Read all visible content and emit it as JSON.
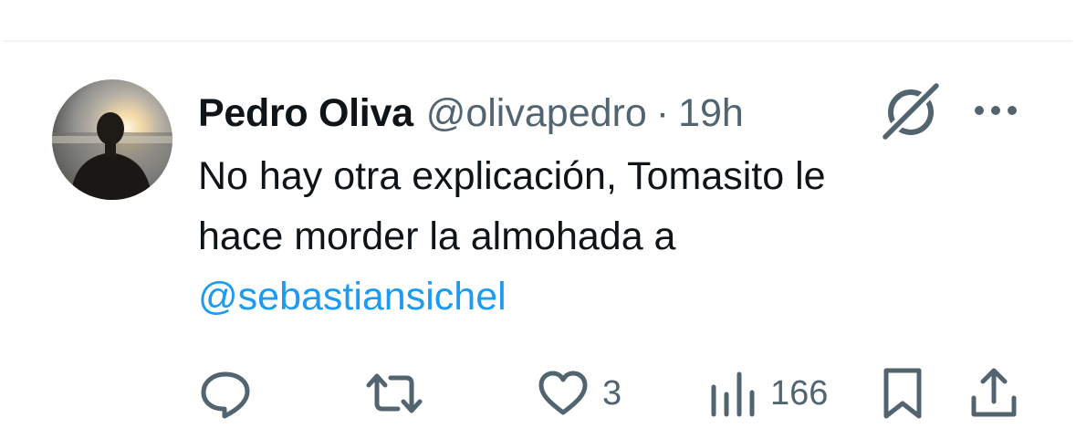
{
  "tweet": {
    "author_name": "Pedro Oliva",
    "author_handle": "@olivapedro",
    "separator": "·",
    "timestamp": "19h",
    "text_lines": [
      "No hay otra explicación, Tomasito le",
      "hace morder la almohada a"
    ],
    "mention": "@sebastiansichel"
  },
  "actions": {
    "likes": "3",
    "views": "166"
  },
  "icons": {
    "avatar": "profile-photo-sunset-silhouette",
    "grok": "grok-icon",
    "more": "more-horizontal-icon",
    "reply": "reply-icon",
    "retweet": "retweet-icon",
    "like": "heart-icon",
    "views": "views-bar-chart-icon",
    "bookmark": "bookmark-icon",
    "share": "share-icon"
  },
  "colors": {
    "text_primary": "#0f1419",
    "text_secondary": "#536471",
    "link": "#1d9bf0",
    "divider": "#eff3f4"
  }
}
